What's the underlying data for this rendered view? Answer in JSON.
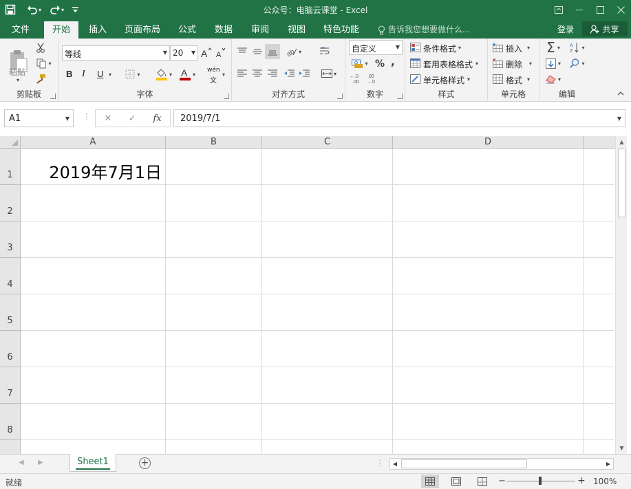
{
  "window": {
    "title": "公众号：电脑云课堂 - Excel",
    "quick_access": {
      "save_icon": "save-icon",
      "undo_icon": "undo-icon",
      "redo_icon": "redo-icon",
      "customize_icon": "customize-qat-icon"
    },
    "controls": [
      "restore-ribbon-icon",
      "minimize-icon",
      "maximize-icon",
      "close-icon"
    ]
  },
  "ribbon_tabs": [
    {
      "label": "文件"
    },
    {
      "label": "开始",
      "active": true
    },
    {
      "label": "插入"
    },
    {
      "label": "页面布局"
    },
    {
      "label": "公式"
    },
    {
      "label": "数据"
    },
    {
      "label": "审阅"
    },
    {
      "label": "视图"
    },
    {
      "label": "特色功能"
    }
  ],
  "tell_me": "告诉我您想要做什么...",
  "login": "登录",
  "share": "共享",
  "ribbon": {
    "clipboard": {
      "label": "剪贴板",
      "paste": "粘贴"
    },
    "font": {
      "label": "字体",
      "font_name": "等线",
      "font_size": "20",
      "bold": "B",
      "italic": "I",
      "underline": "U",
      "phonetic": "wén"
    },
    "alignment": {
      "label": "对齐方式"
    },
    "number": {
      "label": "数字",
      "format": "自定义",
      "percent": "%",
      "comma": ","
    },
    "styles": {
      "label": "样式",
      "conditional": "条件格式",
      "table": "套用表格格式",
      "cell_styles": "单元格样式"
    },
    "cells": {
      "label": "单元格",
      "insert": "插入",
      "delete": "删除",
      "format": "格式"
    },
    "editing": {
      "label": "编辑"
    }
  },
  "formula_bar": {
    "name_box": "A1",
    "fx": "fx",
    "value": "2019/7/1"
  },
  "columns": [
    "A",
    "B",
    "C",
    "D"
  ],
  "rows": [
    "1",
    "2",
    "3",
    "4",
    "5",
    "6",
    "7",
    "8"
  ],
  "cells": {
    "A1": "2019年7月1日"
  },
  "sheets": [
    {
      "name": "Sheet1",
      "active": true
    }
  ],
  "status": {
    "ready": "就绪",
    "zoom": "100%"
  },
  "colors": {
    "accent": "#217346",
    "ribbon_bg": "#f3f3f3",
    "grid_line": "#dadada"
  }
}
